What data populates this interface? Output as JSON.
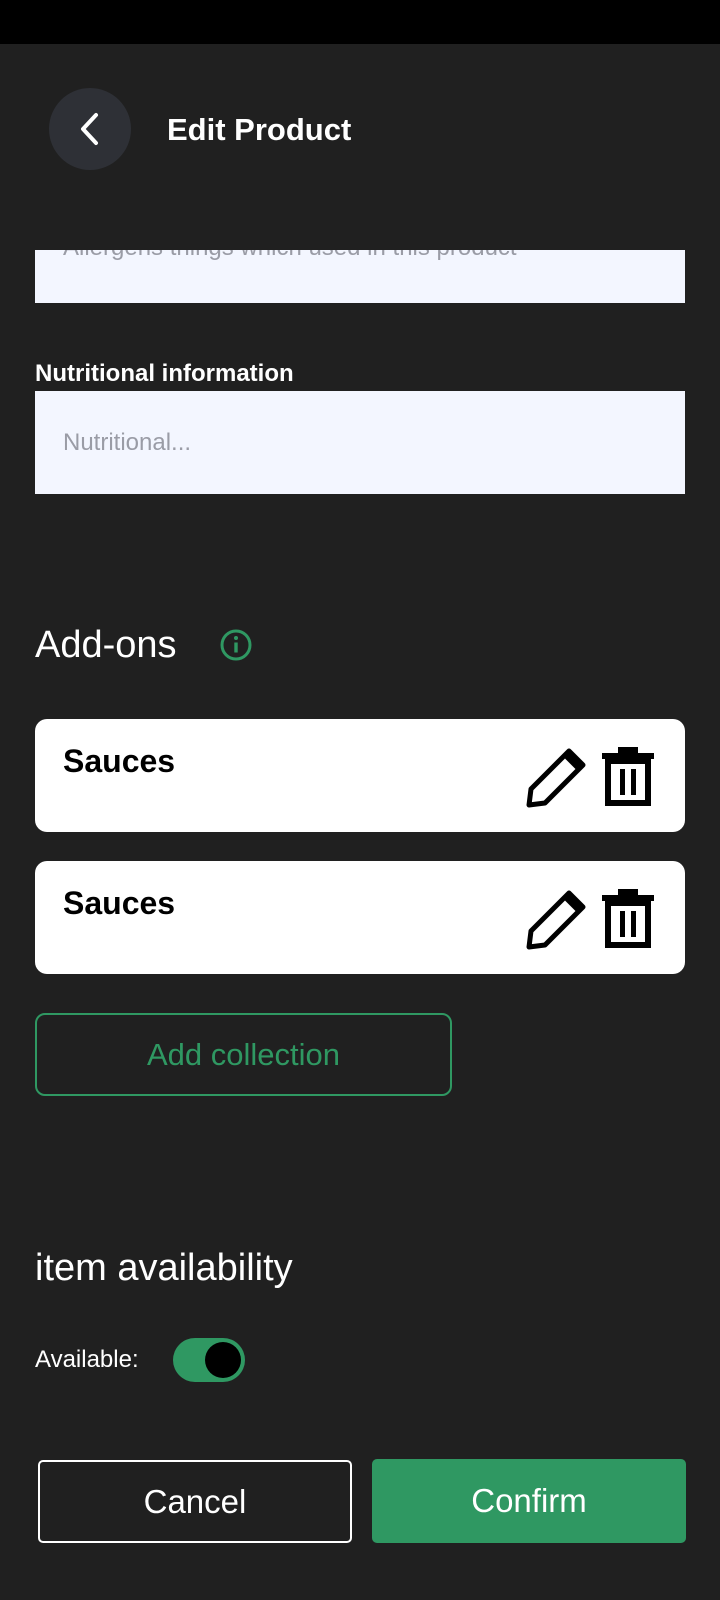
{
  "header": {
    "title": "Edit Product"
  },
  "allergens": {
    "placeholder": "Allergens things which used in this product"
  },
  "nutrition": {
    "label": "Nutritional information",
    "placeholder": "Nutritional..."
  },
  "addons": {
    "title": "Add-ons",
    "items": [
      {
        "name": "Sauces"
      },
      {
        "name": "Sauces"
      }
    ],
    "add_collection_label": "Add collection"
  },
  "availability": {
    "title": "item availability",
    "available_label": "Available:",
    "available": true
  },
  "actions": {
    "cancel_label": "Cancel",
    "confirm_label": "Confirm"
  },
  "colors": {
    "accent": "#2f9862",
    "background": "#202020",
    "field": "#f3f6ff"
  }
}
